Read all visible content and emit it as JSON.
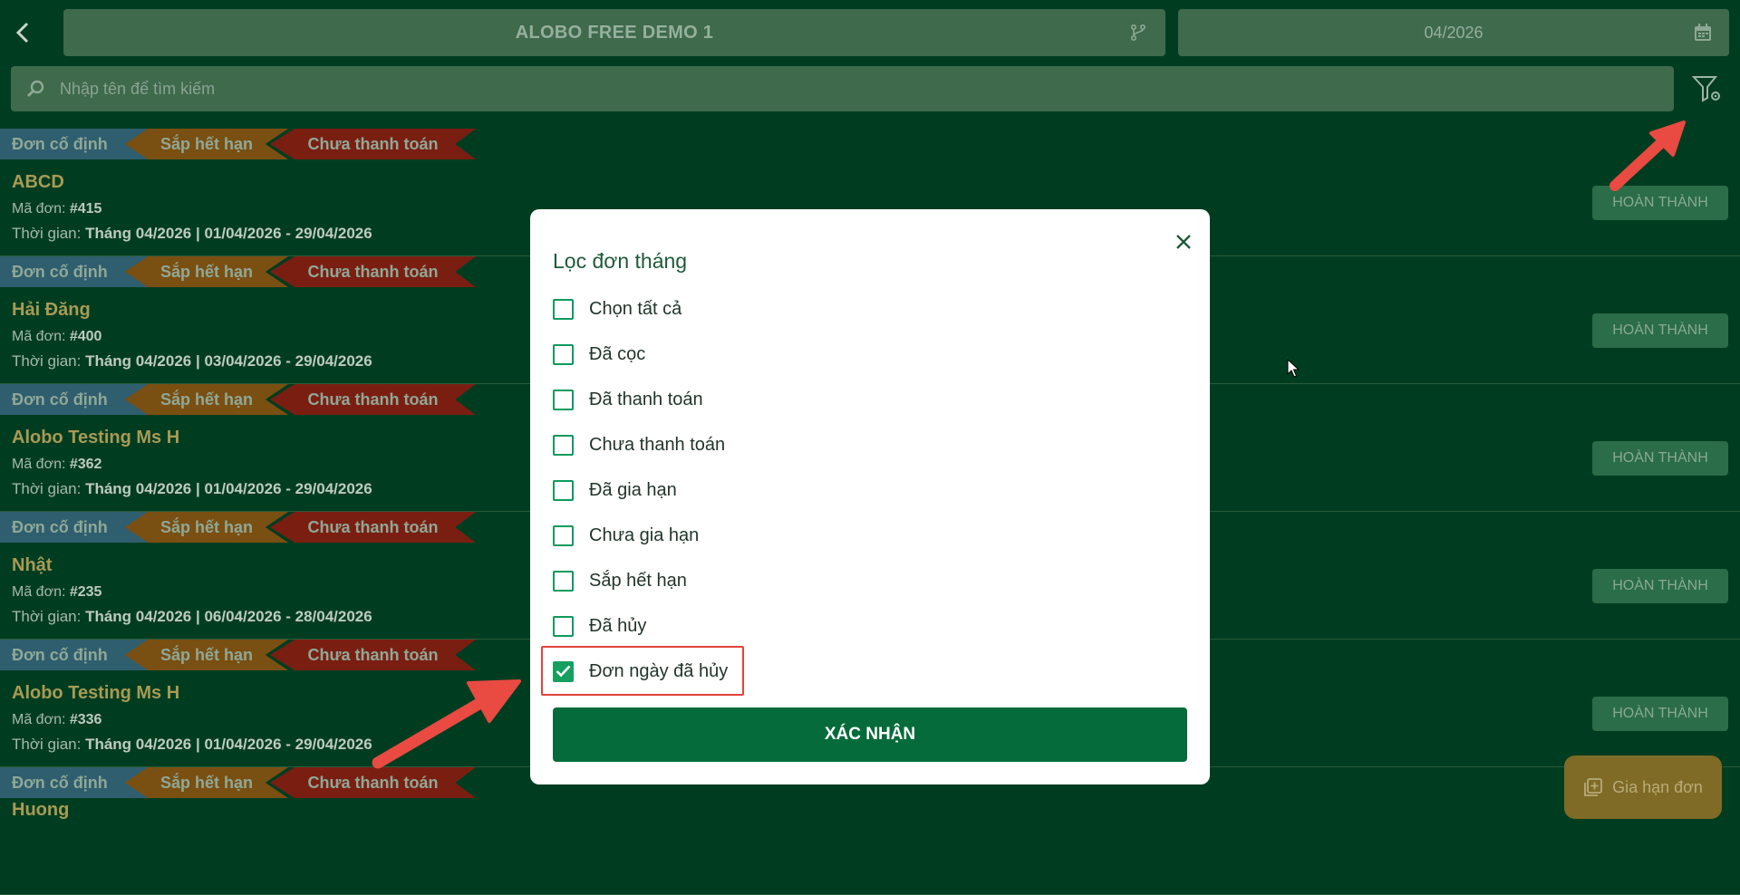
{
  "header": {
    "store_name": "ALOBO FREE DEMO 1",
    "month": "04/2026"
  },
  "search": {
    "placeholder": "Nhập tên để tìm kiếm"
  },
  "tags": {
    "fixed": "Đơn cố định",
    "expiring": "Sắp hết hạn",
    "unpaid": "Chưa thanh toán"
  },
  "labels": {
    "code_prefix": "Mã đơn: ",
    "time_prefix": "Thời gian: ",
    "done_button": "HOÀN THÀNH"
  },
  "orders": [
    {
      "customer": "ABCD",
      "code": "#415",
      "time": "Tháng 04/2026 | 01/04/2026 - 29/04/2026"
    },
    {
      "customer": "Hải Đăng",
      "code": "#400",
      "time": "Tháng 04/2026 | 03/04/2026 - 29/04/2026"
    },
    {
      "customer": "Alobo Testing Ms H",
      "code": "#362",
      "time": "Tháng 04/2026 | 01/04/2026 - 29/04/2026"
    },
    {
      "customer": "Nhật",
      "code": "#235",
      "time": "Tháng 04/2026 | 06/04/2026 - 28/04/2026"
    },
    {
      "customer": "Alobo Testing Ms H",
      "code": "#336",
      "time": "Tháng 04/2026 | 01/04/2026 - 29/04/2026"
    },
    {
      "customer": "Huong"
    }
  ],
  "extend_button": "Gia hạn đơn",
  "filter_modal": {
    "title": "Lọc đơn tháng",
    "options": [
      {
        "label": "Chọn tất cả",
        "checked": false
      },
      {
        "label": "Đã cọc",
        "checked": false
      },
      {
        "label": "Đã thanh toán",
        "checked": false
      },
      {
        "label": "Chưa thanh toán",
        "checked": false
      },
      {
        "label": "Đã gia hạn",
        "checked": false
      },
      {
        "label": "Chưa gia hạn",
        "checked": false
      },
      {
        "label": "Sắp hết hạn",
        "checked": false
      },
      {
        "label": "Đã hủy",
        "checked": false
      },
      {
        "label": "Đơn ngày đã hủy",
        "checked": true
      }
    ],
    "confirm": "XÁC NHẬN"
  },
  "colors": {
    "background": "#003d20",
    "accent": "#066b3a",
    "checkbox": "#15a060",
    "annotation": "#e2433b"
  }
}
